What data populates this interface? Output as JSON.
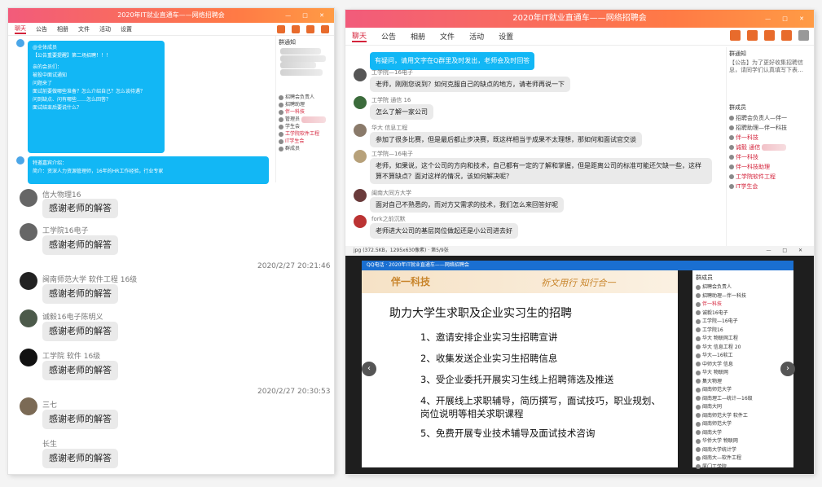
{
  "left": {
    "title": "2020年IT就业直通车——网络招聘会",
    "tabs": [
      "聊天",
      "公告",
      "相册",
      "文件",
      "活动",
      "设置"
    ],
    "side_heading": "群通知",
    "side_members": [
      "招聘会负责人",
      "招聘助理",
      "伴一科技",
      "管理员",
      "学生会",
      "工学院软件工程",
      "IT学生会",
      "群成员"
    ],
    "announce_lines": [
      "@全体成员",
      "【公告重要提醒】第二场招聘！！！",
      "亲的会员们：",
      "被投中面试通知",
      "问题来了",
      "面试前要做哪些准备？怎么介绍自己？怎么谈待遇？",
      "问到缺点、问有哪些……怎么回答？",
      "面试结束后要说什么？"
    ],
    "announce2_lines": [
      "特邀嘉宾介绍：",
      "简介：资深人力资源管理师，16年的HR工作经验，行业专家"
    ],
    "messages": [
      {
        "sender": "信大物理16",
        "text": "感谢老师的解答"
      },
      {
        "sender": "工学院16电子",
        "text": "感谢老师的解答"
      },
      {
        "sender": "闽南师范大学 软件工程 16级",
        "text": "感谢老师的解答"
      },
      {
        "sender": "诚毅16电子陈明义",
        "text": "感谢老师的解答"
      },
      {
        "sender": "工学院 软件 16级",
        "text": "感谢老师的解答"
      },
      {
        "sender": "三七",
        "text": "感谢老师的解答"
      },
      {
        "sender": "长生",
        "text": "感谢老师的解答"
      }
    ],
    "timestamps": [
      "2020/2/27 20:21:46",
      "2020/2/27 20:30:53"
    ]
  },
  "right": {
    "title": "2020年IT就业直通车——网络招聘会",
    "tabs": [
      "聊天",
      "公告",
      "相册",
      "文件",
      "活动",
      "设置"
    ],
    "first_msg": "有疑问，请用文字在Q群里及时发出，老师会及时回答",
    "messages": [
      {
        "sender": "工学院—16电子",
        "text": "老师，刚刚您说到？如何克服自己的缺点的地方，请老师再说一下"
      },
      {
        "sender": "工学院 通信 16",
        "text": "怎么了解一家公司"
      },
      {
        "sender": "华大 信息工程",
        "text": "参加了很多比赛，但是最后都止步决赛，既这样相当于成果不太理想，那如何和面试官交谈"
      },
      {
        "sender": "工学院—16电子",
        "text": "老师，如果说，这个公司的方向和技术，自己都有一定的了解和掌握，但是距离公司的标准可能还欠缺一些，这样算不算缺点？面对这样的情况，该如何解决呢？"
      },
      {
        "sender": "闽南大同方大学",
        "text": "面对自己不熟悉的，而对方又需求的技术，我们怎么来回答好呢"
      },
      {
        "sender": "fork之前沉默",
        "text": "老师进大公司的基层岗位做起还是小公司进去好"
      }
    ],
    "side_heading": "群通知",
    "side_notice": "【公告】为了更好收集招聘信息，请同学们认真填写下表…",
    "members_heading": "群成员",
    "side_members": [
      "招聘会负责人—伴一",
      "招聘助理—伴一科技",
      "伴一科技",
      "诚毅 通信",
      "伴一科技",
      "伴一科技助理",
      "工学院软件工程",
      "IT学生会"
    ],
    "viewer": {
      "file": "jpg (372.5KB，1295x630像素) · 第5/9张",
      "qq_title": "QQ电话 · 2020年IT就业直通车——网络招聘会",
      "logo": "伴一科技",
      "motto": "祈文用行  知行合一",
      "slide_title": "助力大学生求职及企业实习生的招聘",
      "items": [
        "1、邀请安排企业实习生招聘宣讲",
        "2、收集发送企业实习生招聘信息",
        "3、受企业委托开展实习生线上招聘筛选及推送",
        "4、开展线上求职辅导，简历撰写，面试技巧，职业规划、岗位说明等相关求职课程",
        "5、免费开展专业技术辅导及面试技术咨询"
      ],
      "members_heading": "群成员",
      "members": [
        "招聘会负责人",
        "招聘助理—伴一科技",
        "伴一科技",
        "诚毅16电子",
        "工学院—16电子",
        "工学院16",
        "华大 物联网工程",
        "华大 信息工程 20",
        "华大—16软工",
        "中师大学 信息",
        "华大 物联网",
        "集大物理",
        "闽南师范大学",
        "闽南理工—统计—16级",
        "闽南大同",
        "闽南师范大学 软件工",
        "闽南师范大学",
        "闽南大学",
        "华侨大学 物联网",
        "闽南大学统计学",
        "闽南大—软件工程",
        "厦门工学院",
        "厦门工学院软件工",
        "陈明",
        "工学院"
      ]
    }
  }
}
